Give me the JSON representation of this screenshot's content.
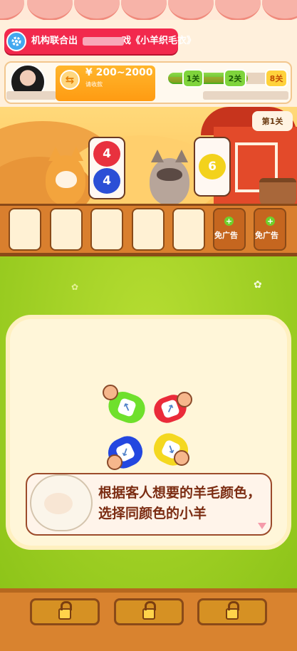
{
  "header": {
    "notice_text": "机构联合出",
    "notice_title": "《小羊织毛衣》",
    "reward_amount": "¥ 200~2000",
    "reward_subtitle": "请收款",
    "exchange_icon": "⇆",
    "levels": [
      "1关",
      "2关",
      "8关"
    ],
    "level_progress": 0.67
  },
  "scene": {
    "current_level": "第1关",
    "customers": [
      {
        "name": "fox",
        "wants": [
          "4",
          "4"
        ],
        "colors": [
          "#e8313e",
          "#2b4fd6"
        ]
      },
      {
        "name": "raccoon",
        "wants": [
          "6"
        ],
        "colors": [
          "#f3d21c"
        ]
      }
    ]
  },
  "slots": {
    "empty_count": 5,
    "ad_label": "免广告",
    "ad_plus": "+"
  },
  "board": {
    "sheep": [
      {
        "color": "#6fe02c",
        "arrow": "↖"
      },
      {
        "color": "#ea2b3a",
        "arrow": "↗"
      },
      {
        "color": "#2347e0",
        "arrow": "↙"
      },
      {
        "color": "#f4d820",
        "arrow": "↘"
      }
    ],
    "tip": "根据客人想要的羊毛颜色，选择同颜色的小羊"
  },
  "bottom": {
    "locked_buttons": 3
  }
}
